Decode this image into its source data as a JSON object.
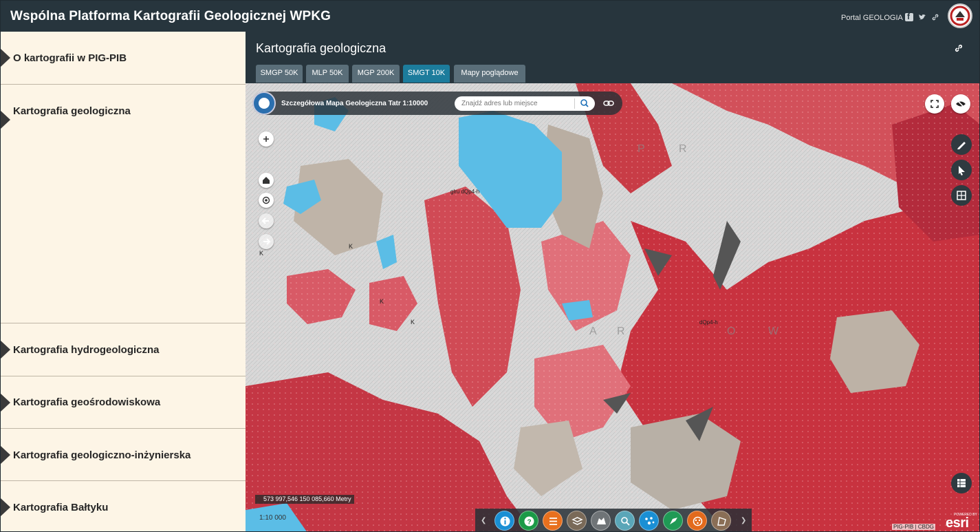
{
  "header": {
    "title": "Wspólna Platforma Kartografii Geologicznej WPKG",
    "portal_link": "Portal GEOLOGIA"
  },
  "sidebar": {
    "items": [
      {
        "label": "O kartografii w PIG-PIB"
      },
      {
        "label": "Kartografia geologiczna"
      },
      {
        "label": "Kartografia hydrogeologiczna"
      },
      {
        "label": "Kartografia geośrodowiskowa"
      },
      {
        "label": "Kartografia geologiczno-inżynierska"
      },
      {
        "label": "Kartografia Bałtyku"
      }
    ]
  },
  "main": {
    "title": "Kartografia geologiczna",
    "tabs": [
      {
        "label": "SMGP 50K"
      },
      {
        "label": "MLP 50K"
      },
      {
        "label": "MGP 200K"
      },
      {
        "label": "SMGT 10K",
        "active": true
      },
      {
        "label": "Mapy poglądowe"
      }
    ]
  },
  "map": {
    "name": "Szczegółowa Mapa Geologiczna Tatr 1:10000",
    "search_placeholder": "Znajdź adres lub miejsce",
    "coordinates": "573 997,546 150 085,660 Metry",
    "scale": "1:10 000",
    "attribution": "PIG-PIB | CBDG",
    "powered_by": "POWERED BY",
    "esri": "esri",
    "tools": [
      {
        "icon": "info-icon",
        "color": "#1a8fd4"
      },
      {
        "icon": "help-icon",
        "color": "#1b9a47"
      },
      {
        "icon": "legend-list-icon",
        "color": "#e8701e"
      },
      {
        "icon": "layers-icon",
        "color": "#7a6a58"
      },
      {
        "icon": "basemap-icon",
        "color": "#6f7477"
      },
      {
        "icon": "query-icon",
        "color": "#5aa6b8"
      },
      {
        "icon": "points-icon",
        "color": "#1a8fd4"
      },
      {
        "icon": "draw-icon",
        "color": "#1f9a55"
      },
      {
        "icon": "analysis-icon",
        "color": "#e26a1c"
      },
      {
        "icon": "measure-icon",
        "color": "#8a6e56"
      }
    ],
    "labels": [
      "K",
      "K",
      "K",
      "K",
      "glru dQp4-h",
      "dQp4-h",
      "P",
      "R",
      "A",
      "R",
      "O",
      "W"
    ]
  }
}
